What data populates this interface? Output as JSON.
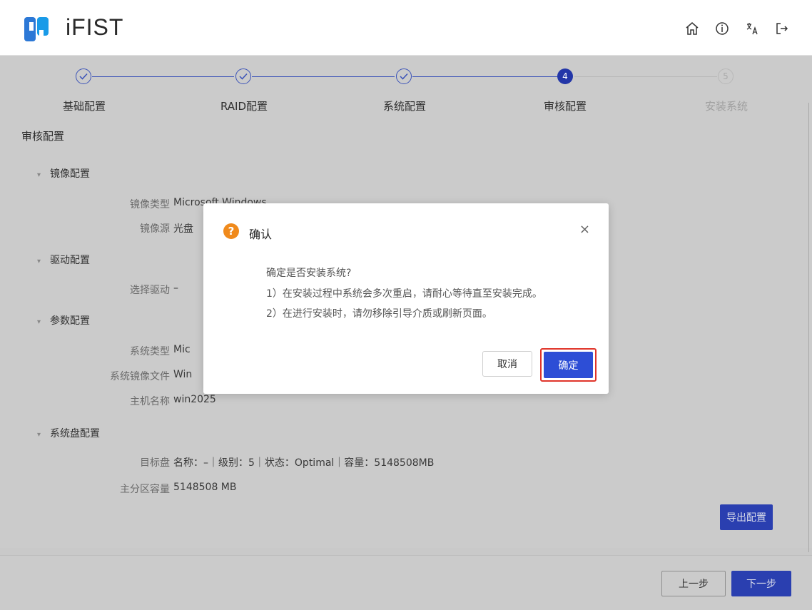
{
  "header": {
    "app_title": "iFIST",
    "icons": [
      "home-icon",
      "info-icon",
      "language-icon",
      "logout-icon"
    ]
  },
  "stepper": {
    "steps": [
      {
        "label": "基础配置",
        "status": "done"
      },
      {
        "label": "RAID配置",
        "status": "done"
      },
      {
        "label": "系统配置",
        "status": "done"
      },
      {
        "label": "审核配置",
        "status": "active",
        "number": "4"
      },
      {
        "label": "安装系统",
        "status": "pending",
        "number": "5"
      }
    ]
  },
  "review": {
    "title": "审核配置",
    "image_group": {
      "title": "镜像配置",
      "type_label": "镜像类型",
      "type_value": "Microsoft Windows",
      "source_label": "镜像源",
      "source_value": "光盘"
    },
    "driver_group": {
      "title": "驱动配置",
      "select_label": "选择驱动",
      "select_value": "–"
    },
    "param_group": {
      "title": "参数配置",
      "os_type_label": "系统类型",
      "os_type_value": "Mic",
      "image_file_label": "系统镜像文件",
      "image_file_value": "Win",
      "hostname_label": "主机名称",
      "hostname_value": "win2025"
    },
    "disk_group": {
      "title": "系统盘配置",
      "target_label": "目标盘",
      "target_value": "名称：–｜级别：5｜状态：Optimal｜容量：5148508MB",
      "partition_label": "主分区容量",
      "partition_value": "5148508 MB"
    },
    "export_button": "导出配置"
  },
  "footer": {
    "prev_button": "上一步",
    "next_button": "下一步"
  },
  "modal": {
    "title": "确认",
    "question": "确定是否安装系统?",
    "line1": "1）在安装过程中系统会多次重启，请耐心等待直至安装完成。",
    "line2": "2）在进行安装时，请勿移除引导介质或刷新页面。",
    "cancel_button": "取消",
    "ok_button": "确定"
  },
  "colors": {
    "accent": "#2336a8",
    "warning": "#f08a1c",
    "highlight": "#e0342a"
  }
}
